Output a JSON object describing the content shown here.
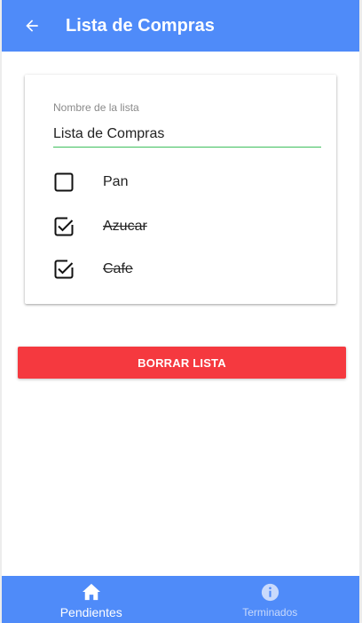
{
  "appbar": {
    "title": "Lista de Compras",
    "back_icon": "arrow-left-icon",
    "color": "#4f8bf9"
  },
  "form": {
    "name_label": "Nombre de la lista",
    "name_value": "Lista de Compras",
    "underline_color": "#3fbf5d"
  },
  "items": [
    {
      "label": "Pan",
      "checked": false
    },
    {
      "label": "Azucar",
      "checked": true
    },
    {
      "label": "Cafe",
      "checked": true
    }
  ],
  "actions": {
    "delete_label": "BORRAR LISTA",
    "delete_color": "#f5393f"
  },
  "bottom_nav": {
    "tabs": [
      {
        "label": "Pendientes",
        "icon": "home-icon",
        "active": true
      },
      {
        "label": "Terminados",
        "icon": "info-icon",
        "active": false
      }
    ]
  }
}
